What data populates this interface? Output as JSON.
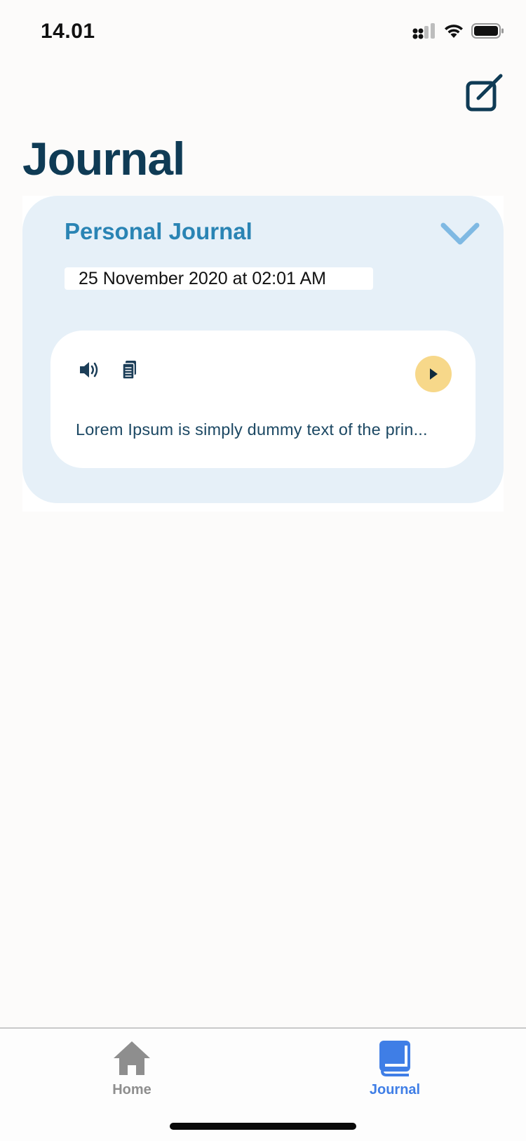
{
  "status_bar": {
    "time": "14.01"
  },
  "header": {
    "title": "Journal",
    "compose_icon": "compose-icon"
  },
  "journal_card": {
    "title": "Personal Journal",
    "date": "25 November 2020 at 02:01 AM",
    "entry": {
      "text": "Lorem Ipsum is simply dummy text of the prin...",
      "icons": [
        "speaker-icon",
        "document-icon",
        "play-icon"
      ]
    }
  },
  "tab_bar": {
    "tabs": [
      {
        "label": "Home",
        "icon": "home-icon",
        "selected": false
      },
      {
        "label": "Journal",
        "icon": "book-icon",
        "selected": true
      }
    ]
  },
  "colors": {
    "title": "#0f3b55",
    "card_background": "#e6f0f8",
    "card_title": "#2a84b4",
    "play_button": "#f7d88a",
    "tab_active": "#3f7ee6",
    "tab_inactive": "#8e8e8e"
  }
}
